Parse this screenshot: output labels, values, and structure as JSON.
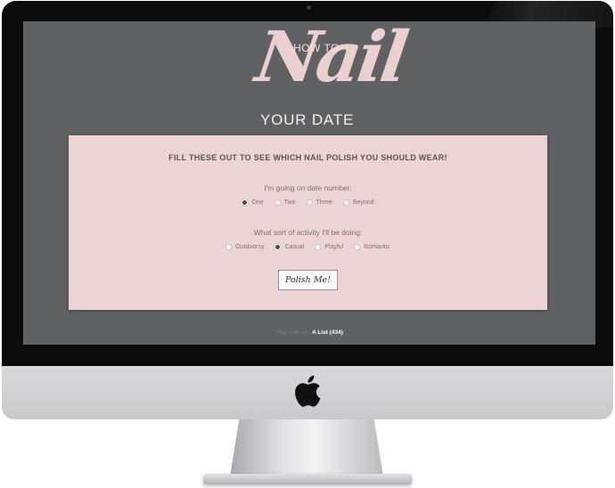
{
  "logo": {
    "how_to": "HOW TO",
    "nail": "Nail",
    "your_date": "YOUR DATE"
  },
  "form": {
    "title": "FILL THESE OUT TO SEE WHICH NAIL POLISH YOU SHOULD WEAR!",
    "question1": {
      "label": "I'm going on date number:",
      "options": [
        "One",
        "Two",
        "Three",
        "Beyond"
      ],
      "selected": "One"
    },
    "question2": {
      "label": "What sort of activity I'll be doing:",
      "options": [
        "Outdoorsy",
        "Casual",
        "Playful",
        "Romantic"
      ],
      "selected": "Casual"
    },
    "submit_label": "Polish Me!"
  },
  "footer": {
    "prefix": "Your vote on",
    "link": "A List (434)"
  },
  "icons": {
    "device_logo": "apple-icon"
  },
  "colors": {
    "screen_bg": "#5f6163",
    "card_bg": "#ebd4d3",
    "logo_pink": "#ead1cf"
  }
}
